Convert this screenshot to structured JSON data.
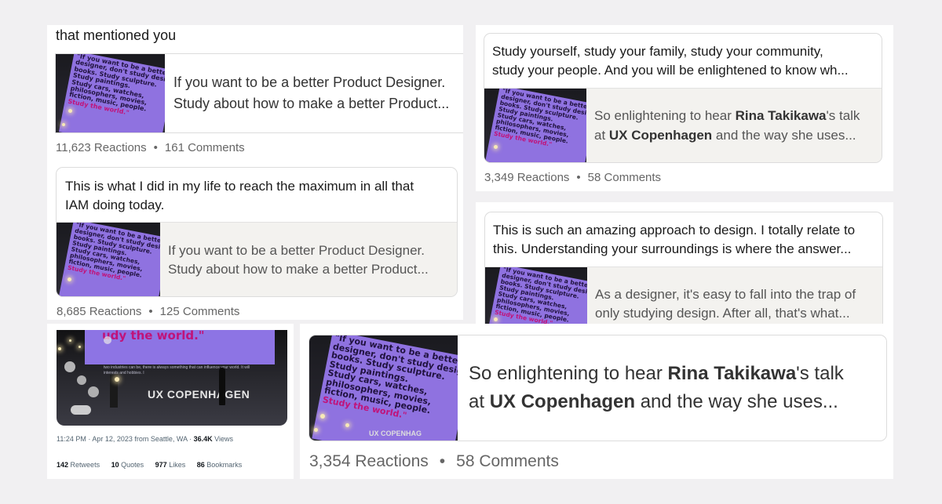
{
  "p1": {
    "header": "that mentioned you",
    "card_share": {
      "line1": "If you want to be a better Product Designer.",
      "line2": "Study about how to make a better Product..."
    },
    "stats": {
      "reactions": "11,623 Reactions",
      "comments": "161 Comments"
    },
    "sep": "•"
  },
  "p2": {
    "quote": {
      "line1": "This is what I did in my life to reach the maximum in all that",
      "line2": "IAM doing today."
    },
    "card_share": {
      "line1": "If you want to be a better Product Designer.",
      "line2": "Study about how to make a better Product..."
    },
    "stats": {
      "reactions": "8,685 Reactions",
      "comments": "125 Comments"
    },
    "sep": "•"
  },
  "p3": {
    "quote": {
      "line1": "Study yourself, study your family, study your community,",
      "line2": "study your people. And you will be enlightened to know wh..."
    },
    "share": {
      "pre1": "So enlightening to hear ",
      "bold1": "Rina Takikawa",
      "post1": "'s talk",
      "pre2": "at ",
      "bold2": "UX Copenhagen",
      "post2": " and the way she uses..."
    },
    "stats": {
      "reactions": "3,349 Reactions",
      "comments": "58 Comments"
    },
    "sep": "•"
  },
  "p4": {
    "quote": {
      "line1": "This is such an amazing approach to design. I totally relate to",
      "line2": "this. Understanding your surroundings is where the answer..."
    },
    "share": {
      "line1": "As a designer, it's easy to fall into the trap of",
      "line2": "only studying design. After all, that's what..."
    }
  },
  "p5": {
    "slide_text": "udy the world.\"",
    "stage_text": "UX COPENHAGEN",
    "stage_sub": "two industries can be, there is always something that can influence your world. It will interests and hobbies. I",
    "meta": {
      "time": "11:24 PM · Apr 12, 2023 from Seattle, WA · ",
      "views_num": "36.4K",
      "views_label": " Views"
    },
    "stats": [
      {
        "num": "142",
        "label": "Retweets"
      },
      {
        "num": "10",
        "label": "Quotes"
      },
      {
        "num": "977",
        "label": "Likes"
      },
      {
        "num": "86",
        "label": "Bookmarks"
      }
    ]
  },
  "p6": {
    "share": {
      "pre1": "So enlightening to hear ",
      "bold1": "Rina Takikawa",
      "post1": "'s talk",
      "pre2": "at ",
      "bold2": "UX Copenhagen",
      "post2": " and the way she uses..."
    },
    "stage_text": "UX COPENHAG",
    "stats": {
      "reactions": "3,354 Reactions",
      "comments": "58 Comments"
    },
    "sep": "•"
  },
  "slide": {
    "lines": [
      "\"If you want to be a better",
      "designer, don't study design",
      "books. Study sculpture.",
      "Study paintings.",
      "Study cars, watches,",
      "philosophers, movies,",
      "fiction, music, people."
    ],
    "highlight": "Study the world.\""
  },
  "colors": {
    "background": "#f1f0f2",
    "slide": "#8f72e0",
    "share_bg": "#f3f2ef"
  }
}
